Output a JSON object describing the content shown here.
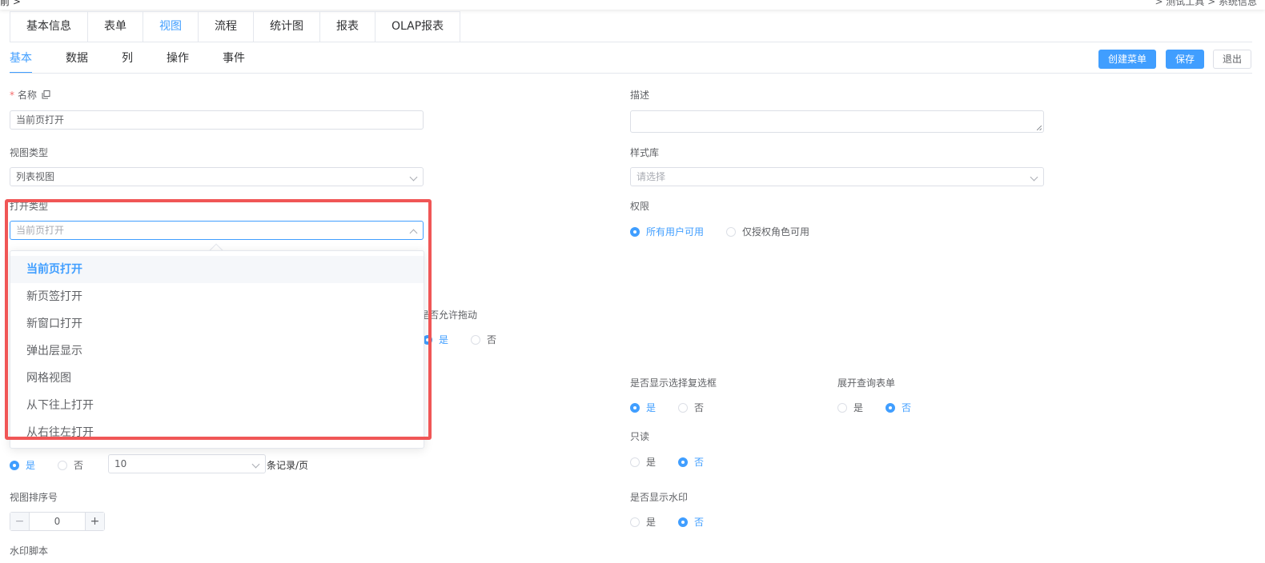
{
  "topbar": {
    "left_text": "前 >",
    "right_text": "> 测试工具 > 系统信息"
  },
  "main_tabs": [
    {
      "label": "基本信息"
    },
    {
      "label": "表单"
    },
    {
      "label": "视图"
    },
    {
      "label": "流程"
    },
    {
      "label": "统计图"
    },
    {
      "label": "报表"
    },
    {
      "label": "OLAP报表"
    }
  ],
  "sub_tabs": [
    {
      "label": "基本"
    },
    {
      "label": "数据"
    },
    {
      "label": "列"
    },
    {
      "label": "操作"
    },
    {
      "label": "事件"
    }
  ],
  "actions": {
    "create_menu": "创建菜单",
    "save": "保存",
    "exit": "退出"
  },
  "form": {
    "name_label": "名称",
    "name_value": "当前页打开",
    "description_label": "描述",
    "view_type_label": "视图类型",
    "view_type_value": "列表视图",
    "style_lib_label": "样式库",
    "style_lib_placeholder": "请选择",
    "open_type_label": "打开类型",
    "open_type_placeholder": "当前页打开",
    "permission_label": "权限",
    "permission_opt1": "所有用户可用",
    "permission_opt2": "仅授权角色可用",
    "drag_label": "是否允许拖动",
    "show_checkbox_label": "是否显示选择复选框",
    "expand_query_label": "展开查询表单",
    "readonly_label": "只读",
    "paging_value": "10",
    "paging_suffix": "条记录/页",
    "sort_label": "视图排序号",
    "sort_value": "0",
    "watermark_label": "是否显示水印",
    "watermark_script_label": "水印脚本",
    "yes": "是",
    "no": "否"
  },
  "dropdown": {
    "options": [
      "当前页打开",
      "新页签打开",
      "新窗口打开",
      "弹出层显示",
      "网格视图",
      "从下往上打开",
      "从右往左打开"
    ],
    "selected": "当前页打开"
  },
  "colors": {
    "accent": "#409eff",
    "highlight": "#f05656"
  }
}
